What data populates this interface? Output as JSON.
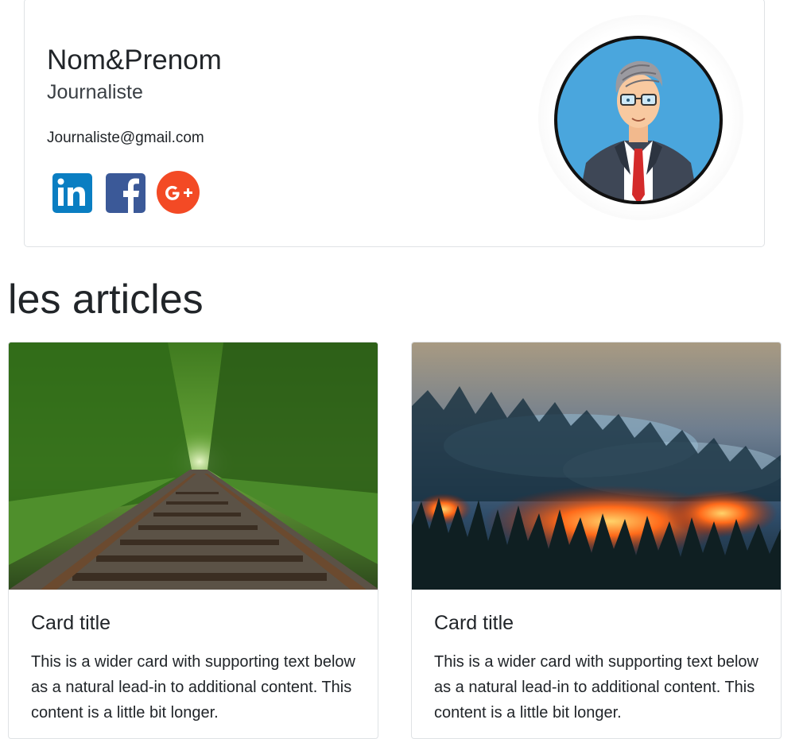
{
  "profile": {
    "name": "Nom&Prenom",
    "role": "Journaliste",
    "email": "Journaliste@gmail.com",
    "social_icons": [
      "linkedin-icon",
      "facebook-icon",
      "google-plus-icon"
    ],
    "social_colors": {
      "linkedin": "#0a7ec2",
      "facebook": "#3b5998",
      "google": "#f34a25"
    }
  },
  "articles_section": {
    "title": "les articles",
    "cards": [
      {
        "image": "railway-forest-photo",
        "title": "Card title",
        "text": "This is a wider card with supporting text below as a natural lead-in to additional content. This content is a little bit longer."
      },
      {
        "image": "forest-fire-photo",
        "title": "Card title",
        "text": "This is a wider card with supporting text below as a natural lead-in to additional content. This content is a little bit longer."
      }
    ]
  }
}
